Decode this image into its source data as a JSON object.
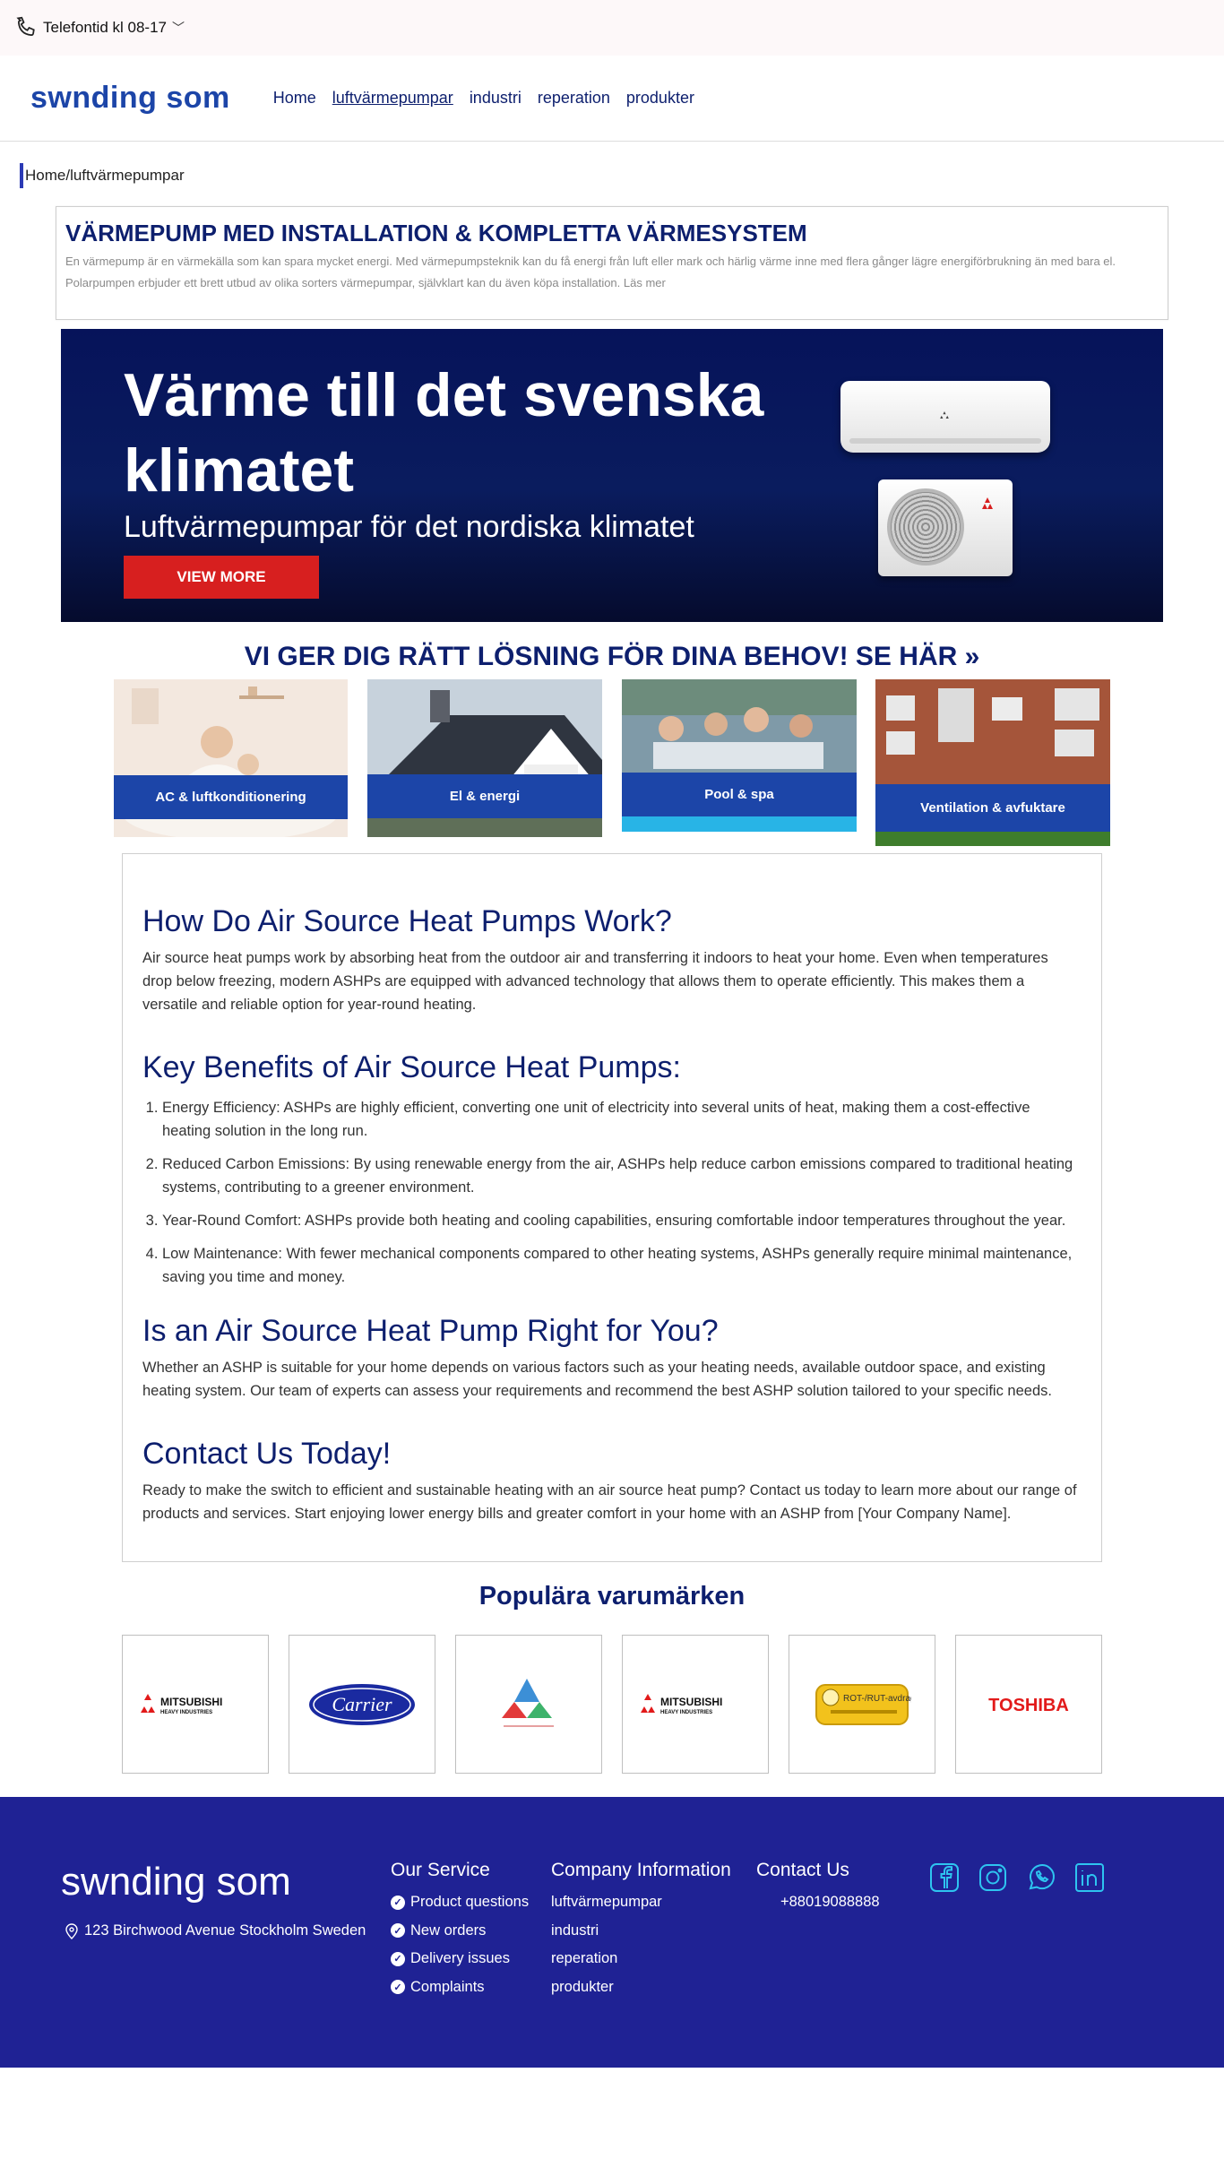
{
  "topbar": {
    "phone_text": "Telefontid kl 08-17",
    "chevron": "﹀"
  },
  "header": {
    "logo": "swnding som",
    "nav": [
      "Home",
      "luftvärmepumpar",
      "industri",
      "reperation",
      "produkter"
    ]
  },
  "breadcrumb": "Home/luftvärmepumpar",
  "intro": {
    "title": "VÄRMEPUMP MED INSTALLATION & KOMPLETTA VÄRMESYSTEM",
    "text": "En värmepump är en värmekälla som kan spara mycket energi. Med värmepumpsteknik kan du få energi från luft eller mark och härlig värme inne med flera gånger lägre energiförbrukning än med bara el. Polarpumpen erbjuder ett brett utbud av olika sorters värmepumpar, självklart kan du även köpa installation. Läs mer"
  },
  "hero": {
    "title": "Värme till det svenska klimatet",
    "subtitle": "Luftvärmepumpar för det nordiska klimatet",
    "button": "VIEW MORE"
  },
  "solution_heading": "VI GER DIG RÄTT LÖSNING FÖR DINA BEHOV! SE HÄR »",
  "categories": [
    {
      "label": "AC & luftkonditionering"
    },
    {
      "label": "El & energi"
    },
    {
      "label": "Pool & spa"
    },
    {
      "label": "Ventilation & avfuktare"
    }
  ],
  "article": {
    "h1": "How Do Air Source Heat Pumps Work?",
    "p1": "Air source heat pumps work by absorbing heat from the outdoor air and transferring it indoors to heat your home. Even when temperatures drop below freezing, modern ASHPs are equipped with advanced technology that allows them to operate efficiently. This makes them a versatile and reliable option for year-round heating.",
    "h2": "Key Benefits of Air Source Heat Pumps:",
    "benefits": [
      "Energy Efficiency: ASHPs are highly efficient, converting one unit of electricity into several units of heat, making them a cost-effective heating solution in the long run.",
      "Reduced Carbon Emissions: By using renewable energy from the air, ASHPs help reduce carbon emissions compared to traditional heating systems, contributing to a greener environment.",
      "Year-Round Comfort: ASHPs provide both heating and cooling capabilities, ensuring comfortable indoor temperatures throughout the year.",
      "Low Maintenance: With fewer mechanical components compared to other heating systems, ASHPs generally require minimal maintenance, saving you time and money."
    ],
    "h3": "Is an Air Source Heat Pump Right for You?",
    "p3": "Whether an ASHP is suitable for your home depends on various factors such as your heating needs, available outdoor space, and existing heating system. Our team of experts can assess your requirements and recommend the best ASHP solution tailored to your specific needs.",
    "h4": "Contact Us Today!",
    "p4": "Ready to make the switch to efficient and sustainable heating with an air source heat pump? Contact us today to learn more about our range of products and services. Start enjoying lower energy bills and greater comfort in your home with an ASHP from [Your Company Name]."
  },
  "brands": {
    "title": "Populära varumärken",
    "items": [
      {
        "name": "MITSUBISHI",
        "sub": "HEAVY INDUSTRIES"
      },
      {
        "name": "Carrier"
      },
      {
        "name": "",
        "sub": ""
      },
      {
        "name": "MITSUBISHI",
        "sub": "HEAVY INDUSTRIES"
      },
      {
        "name": "ROT-/RUT-avdrag"
      },
      {
        "name": "TOSHIBA"
      }
    ]
  },
  "footer": {
    "logo": "swnding som",
    "address": "123 Birchwood Avenue Stockholm Sweden",
    "service_title": "Our Service",
    "service_items": [
      "Product questions",
      "New orders",
      "Delivery issues",
      "Complaints"
    ],
    "company_title": "Company Information",
    "company_items": [
      "luftvärmepumpar",
      "industri",
      "reperation",
      "produkter"
    ],
    "contact_title": "Contact Us",
    "phone": "+88019088888",
    "social_icons": [
      "facebook-icon",
      "instagram-icon",
      "whatsapp-icon",
      "linkedin-icon"
    ]
  },
  "colors": {
    "brand_blue": "#1c45a8",
    "navy": "#0d1f6e",
    "footer": "#1f2294",
    "cta_red": "#d71f1f",
    "social_cyan": "#2ec4f0"
  }
}
